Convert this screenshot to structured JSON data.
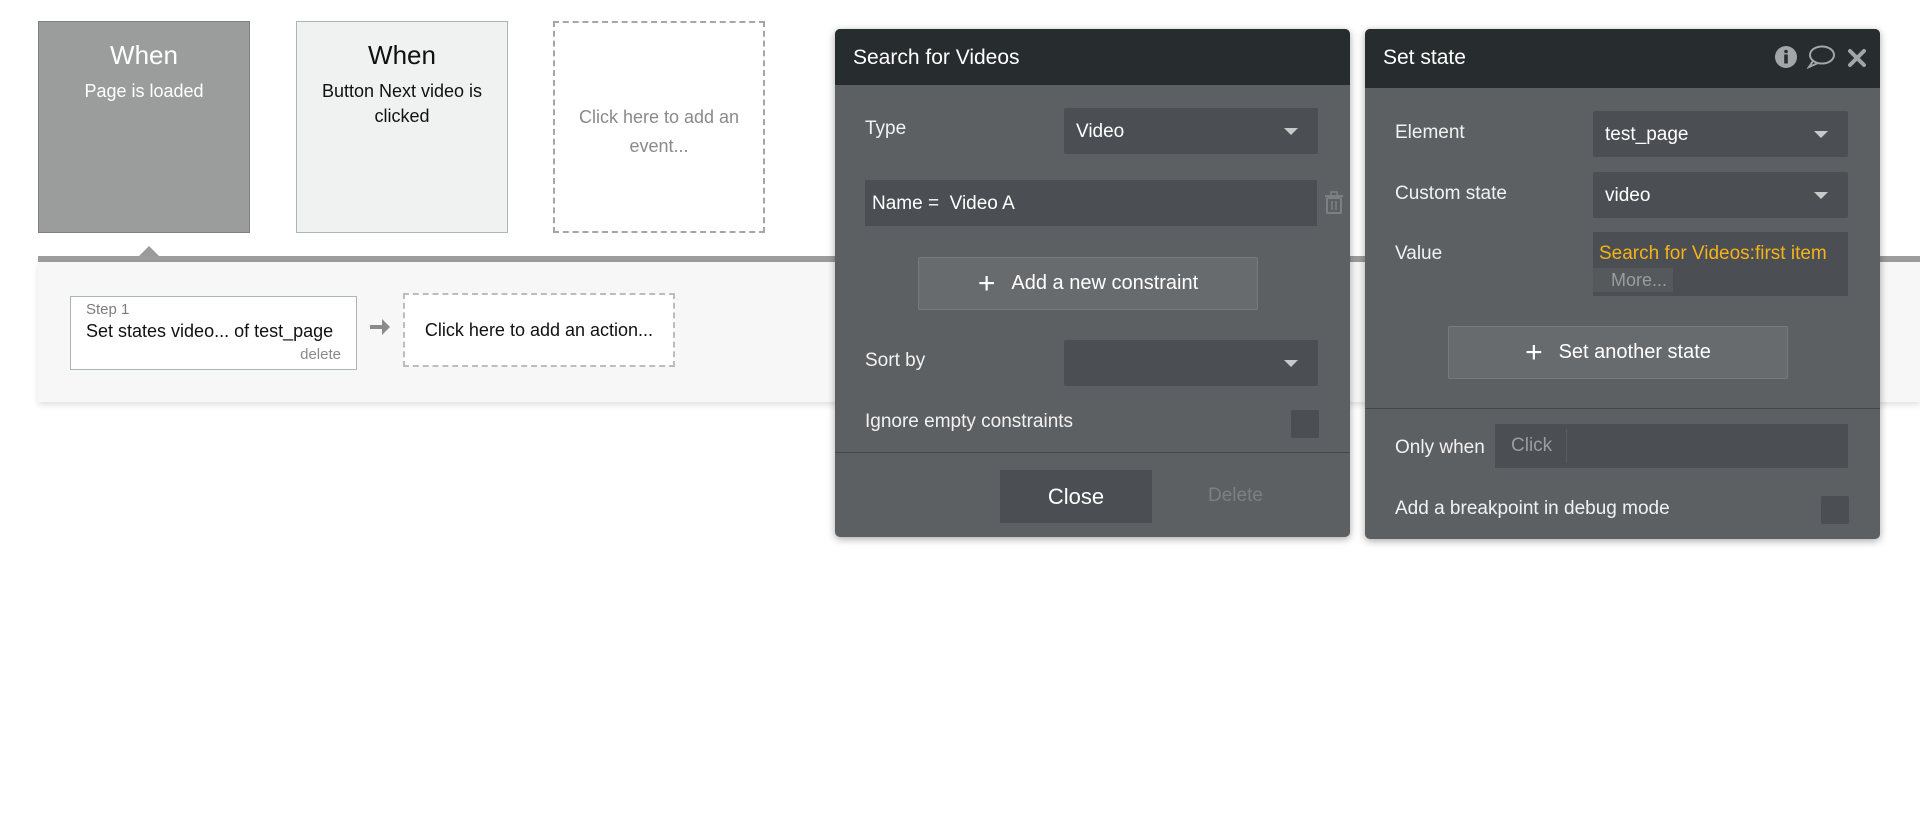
{
  "events": [
    {
      "when": "When",
      "desc": "Page is loaded"
    },
    {
      "when": "When",
      "desc": "Button Next video is clicked"
    }
  ],
  "add_event_label": "Click here to add an event...",
  "step": {
    "number": "Step 1",
    "text": "Set states video... of test_page",
    "delete_label": "delete"
  },
  "add_action_label": "Click here to add an action...",
  "search_panel": {
    "title": "Search for Videos",
    "type_label": "Type",
    "type_value": "Video",
    "constraint_text": "Name =  Video A",
    "add_constraint_label": "Add a new constraint",
    "sort_by_label": "Sort by",
    "sort_by_value": "",
    "ignore_empty_label": "Ignore empty constraints",
    "close_label": "Close",
    "delete_label": "Delete"
  },
  "set_state_panel": {
    "title": "Set state",
    "element_label": "Element",
    "element_value": "test_page",
    "custom_state_label": "Custom state",
    "custom_state_value": "video",
    "value_label": "Value",
    "value_expression": "Search for Videos:first item",
    "more_label": "More...",
    "set_another_label": "Set another state",
    "only_when_label": "Only when",
    "only_when_placeholder": "Click",
    "breakpoint_label": "Add a breakpoint in debug mode"
  },
  "colors": {
    "panel_bg": "#5d6063",
    "panel_header": "#272c2f",
    "input_bg": "#4b4e52",
    "expression_orange": "#f5b318",
    "event_selected": "#9b9c9c"
  },
  "icons": [
    "info-icon",
    "comment-icon",
    "close-icon",
    "trash-icon",
    "arrow-right-icon",
    "plus-icon",
    "chevron-down-icon"
  ]
}
